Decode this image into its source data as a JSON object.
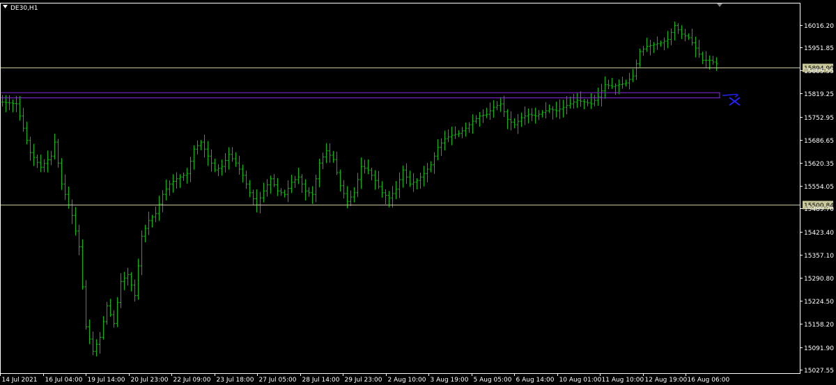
{
  "chart_data": {
    "type": "line",
    "title": "DE30,H1",
    "colors": {
      "background": "#000000",
      "frame": "#ffffff",
      "bars": "#00c000",
      "hline": "#c8c89a",
      "hline_label_bg": "#c8c89a",
      "rectangle": "#8a2be2",
      "marker": "#2222ff"
    },
    "y_ticks": [
      "16016.20",
      "15951.85",
      "15885.55",
      "15819.25",
      "15752.95",
      "15686.65",
      "15620.35",
      "15554.05",
      "15489.70",
      "15423.40",
      "15357.10",
      "15290.80",
      "15224.50",
      "15158.20",
      "15091.90",
      "15027.55"
    ],
    "y_tick_values": [
      16016.2,
      15951.85,
      15885.55,
      15819.25,
      15752.95,
      15686.65,
      15620.35,
      15554.05,
      15489.7,
      15423.4,
      15357.1,
      15290.8,
      15224.5,
      15158.2,
      15091.9,
      15027.55
    ],
    "ylim": [
      15017.0,
      16080.0
    ],
    "x_ticks": [
      "14 Jul 2021",
      "16 Jul 04:00",
      "19 Jul 14:00",
      "20 Jul 23:00",
      "22 Jul 09:00",
      "23 Jul 18:00",
      "27 Jul 05:00",
      "28 Jul 14:00",
      "29 Jul 23:00",
      "2 Aug 10:00",
      "3 Aug 19:00",
      "5 Aug 05:00",
      "6 Aug 14:00",
      "10 Aug 01:00",
      "11 Aug 10:00",
      "12 Aug 19:00",
      "16 Aug 06:00"
    ],
    "bar_count": 206,
    "anchors": [
      [
        0,
        15795
      ],
      [
        4,
        15790
      ],
      [
        6,
        15720
      ],
      [
        8,
        15650
      ],
      [
        11,
        15608
      ],
      [
        14,
        15640
      ],
      [
        15,
        15680
      ],
      [
        17,
        15560
      ],
      [
        20,
        15470
      ],
      [
        22,
        15380
      ],
      [
        24,
        15150
      ],
      [
        26,
        15080
      ],
      [
        28,
        15120
      ],
      [
        30,
        15210
      ],
      [
        32,
        15160
      ],
      [
        34,
        15280
      ],
      [
        36,
        15300
      ],
      [
        38,
        15240
      ],
      [
        40,
        15410
      ],
      [
        42,
        15455
      ],
      [
        44,
        15475
      ],
      [
        46,
        15530
      ],
      [
        48,
        15560
      ],
      [
        50,
        15575
      ],
      [
        53,
        15590
      ],
      [
        55,
        15660
      ],
      [
        57,
        15680
      ],
      [
        59,
        15640
      ],
      [
        61,
        15600
      ],
      [
        63,
        15610
      ],
      [
        65,
        15645
      ],
      [
        67,
        15620
      ],
      [
        69,
        15585
      ],
      [
        71,
        15535
      ],
      [
        73,
        15500
      ],
      [
        75,
        15540
      ],
      [
        77,
        15575
      ],
      [
        79,
        15540
      ],
      [
        81,
        15530
      ],
      [
        83,
        15565
      ],
      [
        85,
        15580
      ],
      [
        87,
        15540
      ],
      [
        89,
        15530
      ],
      [
        91,
        15620
      ],
      [
        93,
        15655
      ],
      [
        95,
        15630
      ],
      [
        97,
        15555
      ],
      [
        99,
        15510
      ],
      [
        101,
        15535
      ],
      [
        103,
        15610
      ],
      [
        105,
        15600
      ],
      [
        107,
        15570
      ],
      [
        109,
        15535
      ],
      [
        111,
        15520
      ],
      [
        113,
        15545
      ],
      [
        115,
        15600
      ],
      [
        117,
        15560
      ],
      [
        119,
        15570
      ],
      [
        121,
        15590
      ],
      [
        123,
        15615
      ],
      [
        125,
        15665
      ],
      [
        127,
        15690
      ],
      [
        129,
        15700
      ],
      [
        131,
        15705
      ],
      [
        133,
        15720
      ],
      [
        135,
        15740
      ],
      [
        137,
        15755
      ],
      [
        139,
        15760
      ],
      [
        141,
        15780
      ],
      [
        143,
        15790
      ],
      [
        145,
        15745
      ],
      [
        147,
        15730
      ],
      [
        149,
        15750
      ],
      [
        151,
        15760
      ],
      [
        153,
        15755
      ],
      [
        155,
        15765
      ],
      [
        157,
        15775
      ],
      [
        159,
        15770
      ],
      [
        161,
        15780
      ],
      [
        163,
        15790
      ],
      [
        165,
        15800
      ],
      [
        167,
        15795
      ],
      [
        169,
        15790
      ],
      [
        171,
        15810
      ],
      [
        173,
        15845
      ],
      [
        175,
        15840
      ],
      [
        177,
        15845
      ],
      [
        179,
        15850
      ],
      [
        181,
        15870
      ],
      [
        183,
        15940
      ],
      [
        185,
        15955
      ],
      [
        187,
        15960
      ],
      [
        189,
        15965
      ],
      [
        191,
        15975
      ],
      [
        193,
        16015
      ],
      [
        195,
        15990
      ],
      [
        197,
        15980
      ],
      [
        199,
        15950
      ],
      [
        201,
        15915
      ],
      [
        203,
        15915
      ],
      [
        205,
        15905
      ]
    ],
    "h_lines": [
      {
        "value": 15894.9,
        "label": "15894.90"
      },
      {
        "value": 15500.84,
        "label": "15500.84"
      }
    ],
    "zone": {
      "top": 15823,
      "bottom": 15808,
      "end_bar": 206
    }
  }
}
